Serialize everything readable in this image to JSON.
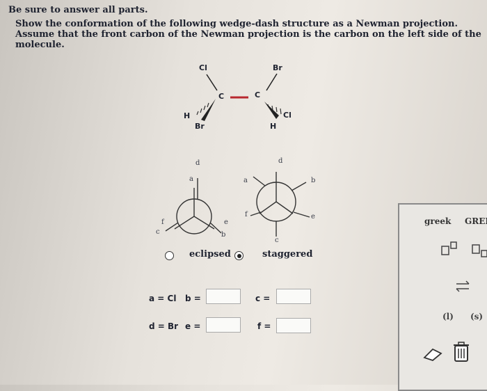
{
  "header": {
    "title": "Be sure to answer all parts.",
    "instruction": "Show the conformation of the following wedge-dash structure as a Newman projection. Assume that the front carbon of the Newman projection is the carbon on the left side of the molecule."
  },
  "molecule": {
    "left_top": "Cl",
    "left_h": "H",
    "left_bottom": "Br",
    "left_c": "C",
    "right_top": "Br",
    "right_c": "C",
    "right_cl": "Cl",
    "right_bottom": "H"
  },
  "newman_eclipsed": {
    "a": "a",
    "b": "b",
    "c": "c",
    "d": "d",
    "e": "e",
    "f": "f"
  },
  "newman_staggered": {
    "a": "a",
    "b": "b",
    "c": "c",
    "d": "d",
    "e": "e",
    "f": "f"
  },
  "conformation": {
    "options": [
      "eclipsed",
      "staggered"
    ],
    "selected": "staggered"
  },
  "answers": {
    "a_label": "a = Cl",
    "b_label": "b =",
    "c_label": "c =",
    "d_label": "d = Br",
    "e_label": "e =",
    "f_label": "f ="
  },
  "tool_panel": {
    "greek": "greek",
    "greek_caps": "GREI",
    "state_l": "(l)",
    "state_s": "(s)"
  }
}
